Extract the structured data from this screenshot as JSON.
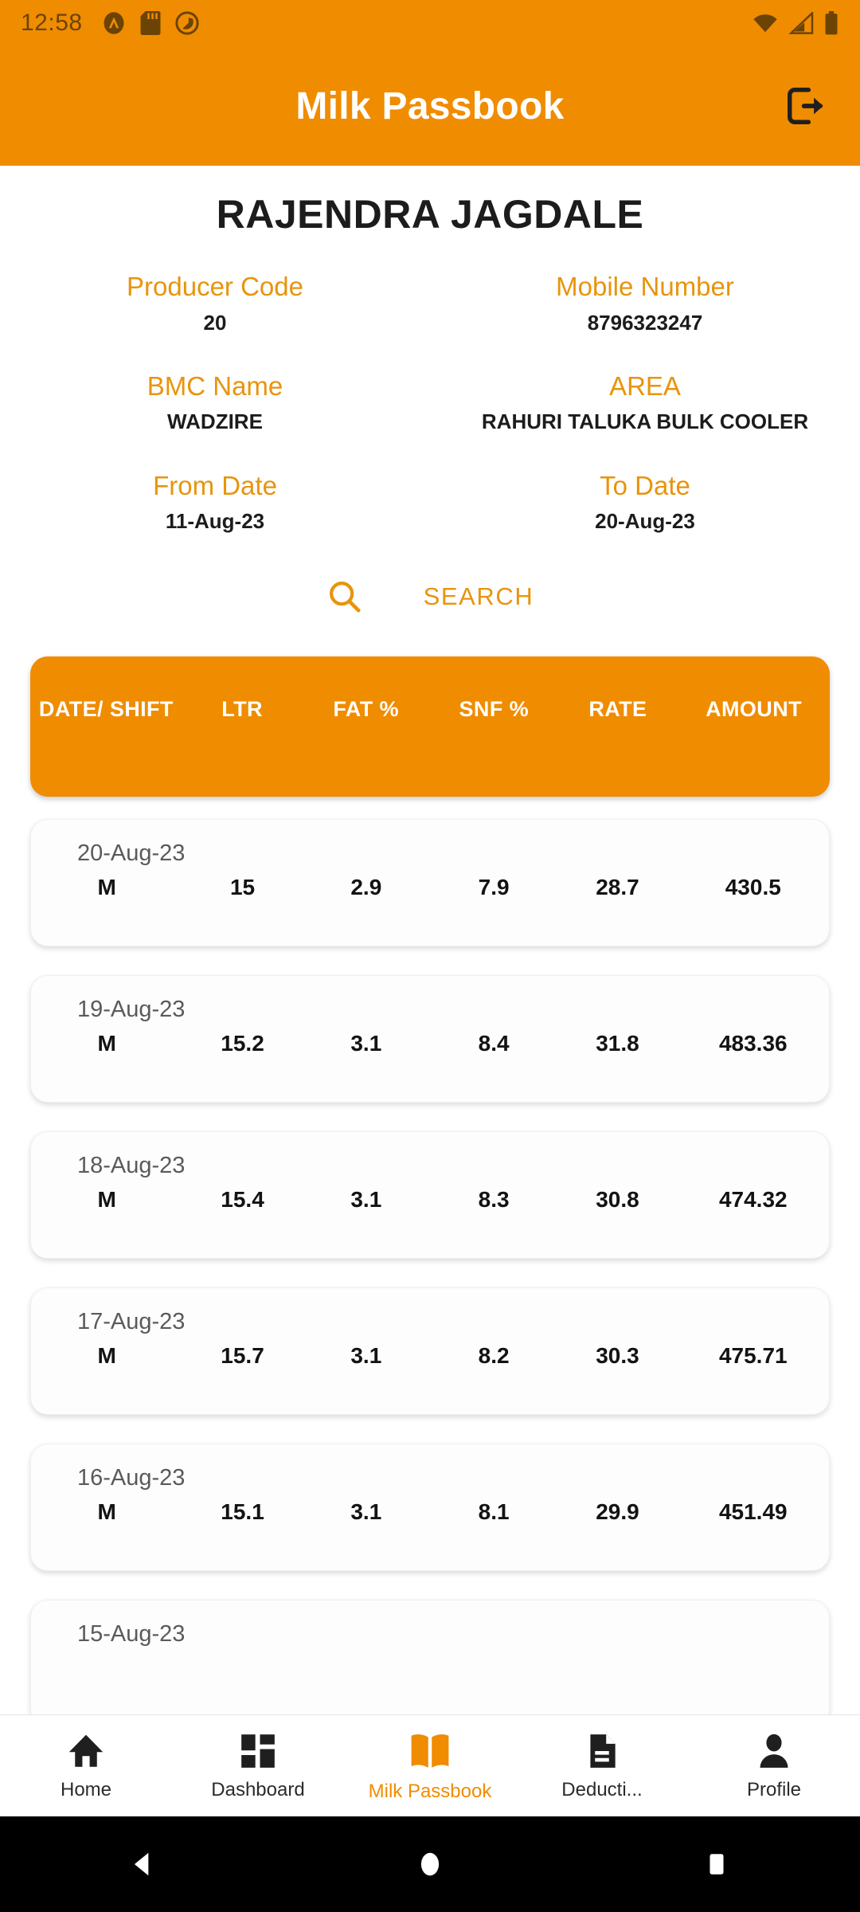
{
  "status_bar": {
    "time": "12:58",
    "left_icons": [
      "app-notification-icon",
      "sd-card-icon",
      "mute-icon"
    ],
    "right_icons": [
      "wifi-icon",
      "cellular-signal-icon",
      "battery-icon"
    ]
  },
  "app_bar": {
    "title": "Milk Passbook",
    "logout_icon": "logout-icon",
    "background": "#F08C00"
  },
  "producer": {
    "name": "RAJENDRA JAGDALE",
    "fields": [
      [
        {
          "label": "Producer Code",
          "value": "20"
        },
        {
          "label": "Mobile Number",
          "value": "8796323247"
        }
      ],
      [
        {
          "label": "BMC Name",
          "value": "WADZIRE"
        },
        {
          "label": "AREA",
          "value": "RAHURI TALUKA BULK COOLER"
        }
      ],
      [
        {
          "label": "From Date",
          "value": "11-Aug-23"
        },
        {
          "label": "To Date",
          "value": "20-Aug-23"
        }
      ]
    ]
  },
  "search": {
    "icon": "search-icon",
    "label": "SEARCH",
    "color": "#E8940C"
  },
  "table": {
    "headers": [
      "DATE/ SHIFT",
      "LTR",
      "FAT %",
      "SNF %",
      "RATE",
      "AMOUNT"
    ],
    "header_bg": "#F08C00",
    "rows": [
      {
        "date": "20-Aug-23",
        "shift": "M",
        "ltr": "15",
        "fat": "2.9",
        "snf": "7.9",
        "rate": "28.7",
        "amount": "430.5"
      },
      {
        "date": "19-Aug-23",
        "shift": "M",
        "ltr": "15.2",
        "fat": "3.1",
        "snf": "8.4",
        "rate": "31.8",
        "amount": "483.36"
      },
      {
        "date": "18-Aug-23",
        "shift": "M",
        "ltr": "15.4",
        "fat": "3.1",
        "snf": "8.3",
        "rate": "30.8",
        "amount": "474.32"
      },
      {
        "date": "17-Aug-23",
        "shift": "M",
        "ltr": "15.7",
        "fat": "3.1",
        "snf": "8.2",
        "rate": "30.3",
        "amount": "475.71"
      },
      {
        "date": "16-Aug-23",
        "shift": "M",
        "ltr": "15.1",
        "fat": "3.1",
        "snf": "8.1",
        "rate": "29.9",
        "amount": "451.49"
      },
      {
        "date": "15-Aug-23",
        "shift": "",
        "ltr": "",
        "fat": "",
        "snf": "",
        "rate": "",
        "amount": ""
      }
    ]
  },
  "bottom_nav": {
    "items": [
      {
        "label": "Home",
        "icon": "home-icon",
        "active": false
      },
      {
        "label": "Dashboard",
        "icon": "dashboard-grid-icon",
        "active": false
      },
      {
        "label": "Milk Passbook",
        "icon": "open-book-icon",
        "active": true
      },
      {
        "label": "Deducti...",
        "icon": "document-icon",
        "active": false
      },
      {
        "label": "Profile",
        "icon": "person-icon",
        "active": false
      }
    ],
    "active_color": "#F08C00"
  },
  "android_nav": {
    "buttons": [
      "back-triangle-icon",
      "home-circle-icon",
      "recents-square-icon"
    ]
  }
}
